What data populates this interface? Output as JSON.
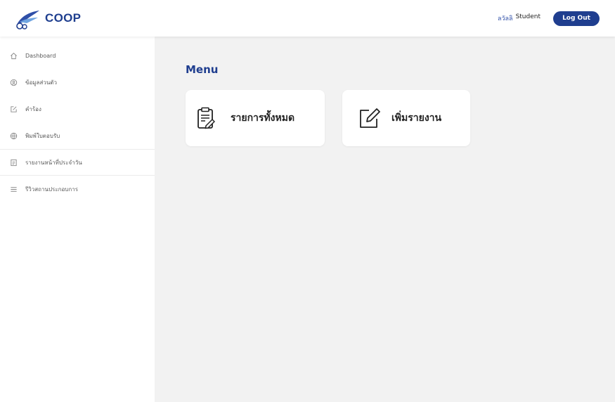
{
  "header": {
    "logo_text": "COOP",
    "user_name": "ลวัลลิ",
    "user_role": "Student",
    "logout_label": "Log Out"
  },
  "sidebar": {
    "items": [
      {
        "label": "Dashboard",
        "icon": "home-icon"
      },
      {
        "label": "ข้อมูลส่วนตัว",
        "icon": "id-icon"
      },
      {
        "label": "คำร้อง",
        "icon": "edit-icon"
      },
      {
        "label": "พิมพ์ใบตอบรับ",
        "icon": "globe-icon"
      },
      {
        "label": "รายงานหน้าที่ประจำวัน",
        "icon": "document-icon",
        "active": true
      },
      {
        "label": "รีวิวสถานประกอบการ",
        "icon": "list-icon"
      }
    ]
  },
  "main": {
    "menu_title": "Menu",
    "cards": [
      {
        "label": "รายการทั้งหมด",
        "icon": "clipboard-icon"
      },
      {
        "label": "เพิ่มรายงาน",
        "icon": "edit-icon"
      }
    ]
  },
  "colors": {
    "brand": "#1f3e8f",
    "main_bg": "#f2f2f2",
    "card_bg": "#ffffff"
  }
}
